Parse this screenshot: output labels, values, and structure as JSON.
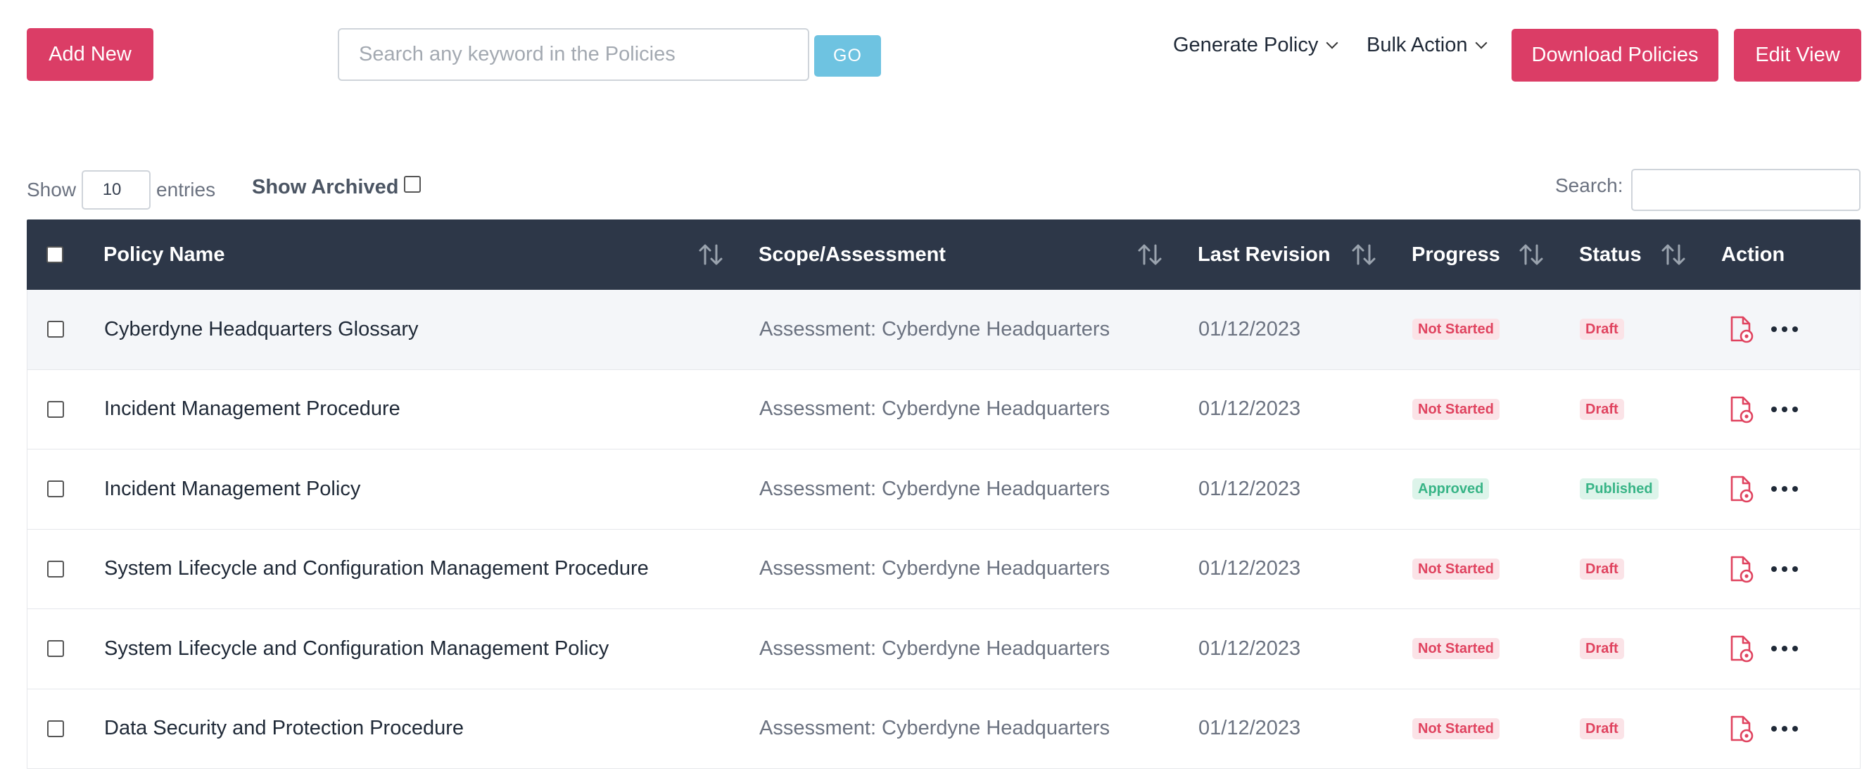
{
  "toolbar": {
    "add_new": "Add New",
    "search_placeholder": "Search any keyword in the Policies",
    "go": "GO",
    "generate_policy": "Generate Policy",
    "bulk_action": "Bulk Action",
    "download_policies": "Download Policies",
    "edit_view": "Edit View"
  },
  "controls": {
    "show": "Show",
    "entries_value": "10",
    "entries": "entries",
    "show_archived": "Show Archived",
    "search_label": "Search:"
  },
  "columns": {
    "policy_name": "Policy Name",
    "scope": "Scope/Assessment",
    "last_revision": "Last Revision",
    "progress": "Progress",
    "status": "Status",
    "action": "Action"
  },
  "colors": {
    "accent": "#db3d66",
    "header_bg": "#2d3748",
    "go_button": "#6ec3e1",
    "badge_red": "#e0435f",
    "badge_green": "#37b486"
  },
  "rows": [
    {
      "name": "Cyberdyne Headquarters Glossary",
      "scope": "Assessment: Cyberdyne Headquarters",
      "revision": "01/12/2023",
      "progress": "Not Started",
      "progress_tone": "red",
      "status": "Draft",
      "status_tone": "red"
    },
    {
      "name": "Incident Management Procedure",
      "scope": "Assessment: Cyberdyne Headquarters",
      "revision": "01/12/2023",
      "progress": "Not Started",
      "progress_tone": "red",
      "status": "Draft",
      "status_tone": "red"
    },
    {
      "name": "Incident Management Policy",
      "scope": "Assessment: Cyberdyne Headquarters",
      "revision": "01/12/2023",
      "progress": "Approved",
      "progress_tone": "green",
      "status": "Published",
      "status_tone": "green"
    },
    {
      "name": "System Lifecycle and Configuration Management Procedure",
      "scope": "Assessment: Cyberdyne Headquarters",
      "revision": "01/12/2023",
      "progress": "Not Started",
      "progress_tone": "red",
      "status": "Draft",
      "status_tone": "red"
    },
    {
      "name": "System Lifecycle and Configuration Management Policy",
      "scope": "Assessment: Cyberdyne Headquarters",
      "revision": "01/12/2023",
      "progress": "Not Started",
      "progress_tone": "red",
      "status": "Draft",
      "status_tone": "red"
    },
    {
      "name": "Data Security and Protection Procedure",
      "scope": "Assessment: Cyberdyne Headquarters",
      "revision": "01/12/2023",
      "progress": "Not Started",
      "progress_tone": "red",
      "status": "Draft",
      "status_tone": "red"
    }
  ]
}
